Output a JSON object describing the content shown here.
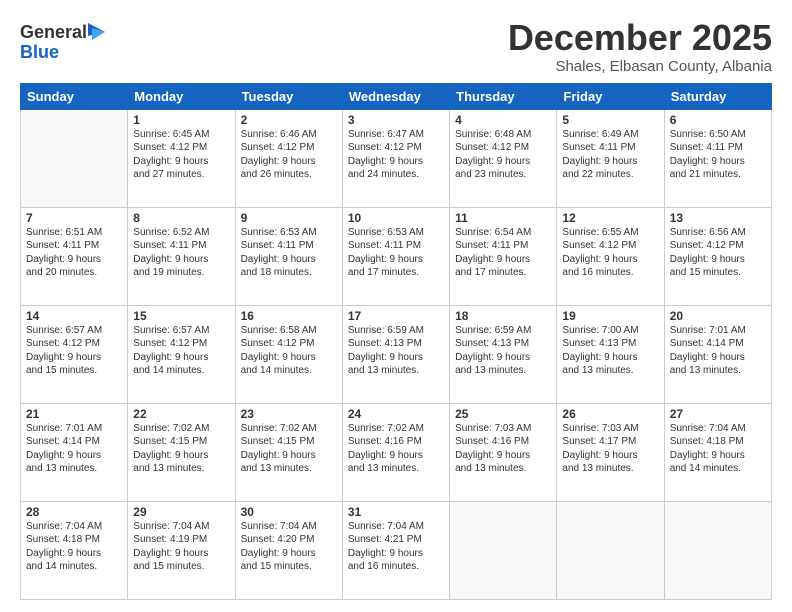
{
  "logo": {
    "line1": "General",
    "line2": "Blue"
  },
  "header": {
    "title": "December 2025",
    "subtitle": "Shales, Elbasan County, Albania"
  },
  "days_of_week": [
    "Sunday",
    "Monday",
    "Tuesday",
    "Wednesday",
    "Thursday",
    "Friday",
    "Saturday"
  ],
  "weeks": [
    [
      {
        "day": "",
        "info": ""
      },
      {
        "day": "1",
        "info": "Sunrise: 6:45 AM\nSunset: 4:12 PM\nDaylight: 9 hours\nand 27 minutes."
      },
      {
        "day": "2",
        "info": "Sunrise: 6:46 AM\nSunset: 4:12 PM\nDaylight: 9 hours\nand 26 minutes."
      },
      {
        "day": "3",
        "info": "Sunrise: 6:47 AM\nSunset: 4:12 PM\nDaylight: 9 hours\nand 24 minutes."
      },
      {
        "day": "4",
        "info": "Sunrise: 6:48 AM\nSunset: 4:12 PM\nDaylight: 9 hours\nand 23 minutes."
      },
      {
        "day": "5",
        "info": "Sunrise: 6:49 AM\nSunset: 4:11 PM\nDaylight: 9 hours\nand 22 minutes."
      },
      {
        "day": "6",
        "info": "Sunrise: 6:50 AM\nSunset: 4:11 PM\nDaylight: 9 hours\nand 21 minutes."
      }
    ],
    [
      {
        "day": "7",
        "info": "Sunrise: 6:51 AM\nSunset: 4:11 PM\nDaylight: 9 hours\nand 20 minutes."
      },
      {
        "day": "8",
        "info": "Sunrise: 6:52 AM\nSunset: 4:11 PM\nDaylight: 9 hours\nand 19 minutes."
      },
      {
        "day": "9",
        "info": "Sunrise: 6:53 AM\nSunset: 4:11 PM\nDaylight: 9 hours\nand 18 minutes."
      },
      {
        "day": "10",
        "info": "Sunrise: 6:53 AM\nSunset: 4:11 PM\nDaylight: 9 hours\nand 17 minutes."
      },
      {
        "day": "11",
        "info": "Sunrise: 6:54 AM\nSunset: 4:11 PM\nDaylight: 9 hours\nand 17 minutes."
      },
      {
        "day": "12",
        "info": "Sunrise: 6:55 AM\nSunset: 4:12 PM\nDaylight: 9 hours\nand 16 minutes."
      },
      {
        "day": "13",
        "info": "Sunrise: 6:56 AM\nSunset: 4:12 PM\nDaylight: 9 hours\nand 15 minutes."
      }
    ],
    [
      {
        "day": "14",
        "info": "Sunrise: 6:57 AM\nSunset: 4:12 PM\nDaylight: 9 hours\nand 15 minutes."
      },
      {
        "day": "15",
        "info": "Sunrise: 6:57 AM\nSunset: 4:12 PM\nDaylight: 9 hours\nand 14 minutes."
      },
      {
        "day": "16",
        "info": "Sunrise: 6:58 AM\nSunset: 4:12 PM\nDaylight: 9 hours\nand 14 minutes."
      },
      {
        "day": "17",
        "info": "Sunrise: 6:59 AM\nSunset: 4:13 PM\nDaylight: 9 hours\nand 13 minutes."
      },
      {
        "day": "18",
        "info": "Sunrise: 6:59 AM\nSunset: 4:13 PM\nDaylight: 9 hours\nand 13 minutes."
      },
      {
        "day": "19",
        "info": "Sunrise: 7:00 AM\nSunset: 4:13 PM\nDaylight: 9 hours\nand 13 minutes."
      },
      {
        "day": "20",
        "info": "Sunrise: 7:01 AM\nSunset: 4:14 PM\nDaylight: 9 hours\nand 13 minutes."
      }
    ],
    [
      {
        "day": "21",
        "info": "Sunrise: 7:01 AM\nSunset: 4:14 PM\nDaylight: 9 hours\nand 13 minutes."
      },
      {
        "day": "22",
        "info": "Sunrise: 7:02 AM\nSunset: 4:15 PM\nDaylight: 9 hours\nand 13 minutes."
      },
      {
        "day": "23",
        "info": "Sunrise: 7:02 AM\nSunset: 4:15 PM\nDaylight: 9 hours\nand 13 minutes."
      },
      {
        "day": "24",
        "info": "Sunrise: 7:02 AM\nSunset: 4:16 PM\nDaylight: 9 hours\nand 13 minutes."
      },
      {
        "day": "25",
        "info": "Sunrise: 7:03 AM\nSunset: 4:16 PM\nDaylight: 9 hours\nand 13 minutes."
      },
      {
        "day": "26",
        "info": "Sunrise: 7:03 AM\nSunset: 4:17 PM\nDaylight: 9 hours\nand 13 minutes."
      },
      {
        "day": "27",
        "info": "Sunrise: 7:04 AM\nSunset: 4:18 PM\nDaylight: 9 hours\nand 14 minutes."
      }
    ],
    [
      {
        "day": "28",
        "info": "Sunrise: 7:04 AM\nSunset: 4:18 PM\nDaylight: 9 hours\nand 14 minutes."
      },
      {
        "day": "29",
        "info": "Sunrise: 7:04 AM\nSunset: 4:19 PM\nDaylight: 9 hours\nand 15 minutes."
      },
      {
        "day": "30",
        "info": "Sunrise: 7:04 AM\nSunset: 4:20 PM\nDaylight: 9 hours\nand 15 minutes."
      },
      {
        "day": "31",
        "info": "Sunrise: 7:04 AM\nSunset: 4:21 PM\nDaylight: 9 hours\nand 16 minutes."
      },
      {
        "day": "",
        "info": ""
      },
      {
        "day": "",
        "info": ""
      },
      {
        "day": "",
        "info": ""
      }
    ]
  ]
}
